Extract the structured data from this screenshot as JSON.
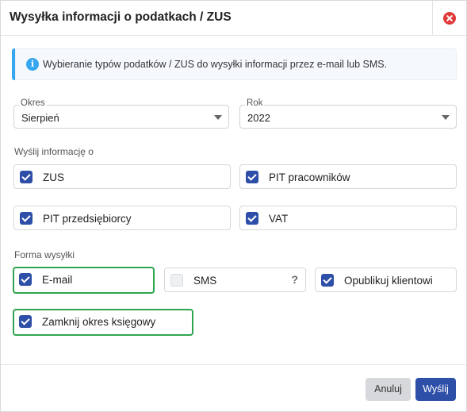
{
  "dialog": {
    "title": "Wysyłka informacji o podatkach / ZUS",
    "close_icon": "close-circle-icon"
  },
  "info": {
    "icon": "info-icon",
    "icon_glyph": "i",
    "text": "Wybieranie typów podatków / ZUS do wysyłki informacji przez e-mail lub SMS."
  },
  "period": {
    "label": "Okres",
    "value": "Sierpień"
  },
  "year": {
    "label": "Rok",
    "value": "2022"
  },
  "send_info": {
    "label": "Wyślij informację o",
    "options": [
      {
        "label": "ZUS",
        "checked": true
      },
      {
        "label": "PIT pracowników",
        "checked": true
      },
      {
        "label": "PIT przedsiębiorcy",
        "checked": true
      },
      {
        "label": "VAT",
        "checked": true
      }
    ]
  },
  "send_form": {
    "label": "Forma wysyłki",
    "options": [
      {
        "label": "E-mail",
        "checked": true
      },
      {
        "label": "SMS",
        "checked": false,
        "help": "?"
      },
      {
        "label": "Opublikuj klientowi",
        "checked": true
      }
    ]
  },
  "close_period": {
    "label": "Zamknij okres księgowy",
    "checked": true
  },
  "buttons": {
    "cancel": "Anuluj",
    "send": "Wyślij"
  },
  "colors": {
    "primary": "#2e4fa8",
    "info_accent": "#35a6f0",
    "close_red": "#e03b3b",
    "highlight_green": "#2ea44f"
  }
}
